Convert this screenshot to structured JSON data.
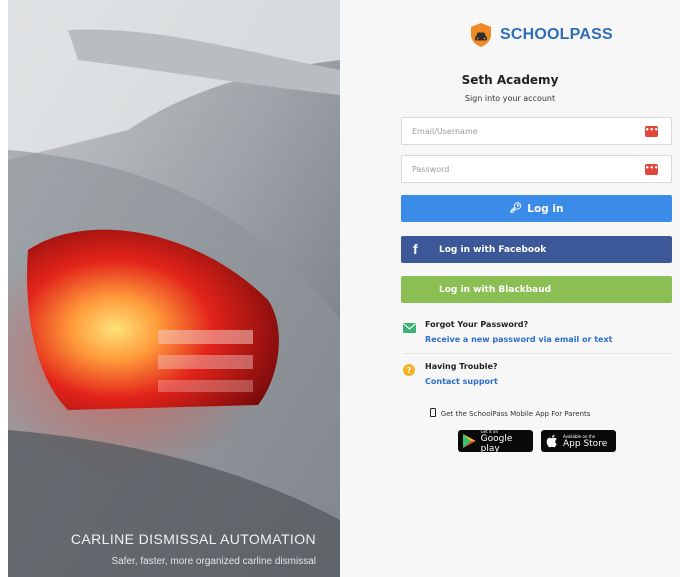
{
  "hero": {
    "title": "CARLINE DISMISSAL AUTOMATION",
    "subtitle": "Safer, faster, more organized carline dismissal"
  },
  "brand": {
    "name": "SCHOOLPASS",
    "logo_icon": "car-shield-icon",
    "color": "#2f6db7"
  },
  "school_name": "Seth Academy",
  "signin_prompt": "Sign into your account",
  "fields": {
    "email": {
      "placeholder": "Email/Username",
      "value": ""
    },
    "password": {
      "placeholder": "Password",
      "value": ""
    }
  },
  "buttons": {
    "login": "Log in",
    "facebook": "Log in with Facebook",
    "blackbaud": "Log in with Blackbaud"
  },
  "help": {
    "forgot_title": "Forgot Your Password?",
    "forgot_link": "Receive a new password via email or text",
    "trouble_title": "Having Trouble?",
    "trouble_link": "Contact support"
  },
  "mobile_app": {
    "note": "Get the SchoolPass Mobile App For Parents",
    "google_small": "Get it on",
    "google_big": "Google play",
    "apple_small": "Available on the",
    "apple_big": "App Store"
  },
  "colors": {
    "login": "#3b8be8",
    "facebook": "#3c5899",
    "blackbaud": "#8bbf54",
    "link": "#2d6ecb",
    "field_icon": "#e0463a"
  }
}
